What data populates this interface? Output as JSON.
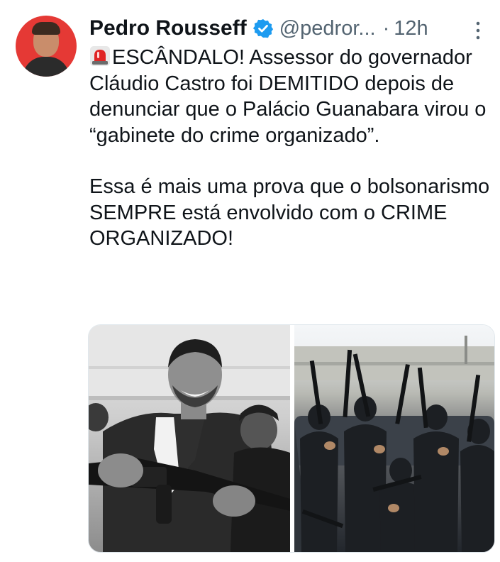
{
  "author": {
    "name": "Pedro Rousseff",
    "handle": "@pedror...",
    "separator": "·",
    "time": "12h",
    "verified": true,
    "avatar_bg": "#e53935"
  },
  "tweet": {
    "emoji": "rotating-light-icon",
    "paragraphs": [
      "ESCÂNDALO! Assessor do governador Cláudio Castro foi DEMITIDO depois de denunciar que o Palácio Guanabara virou o “gabinete do crime organizado”.",
      "Essa é mais uma prova que o bolsonarismo SEMPRE está envolvido com o CRIME ORGANIZADO!"
    ]
  },
  "media": {
    "count": 2,
    "items": [
      {
        "kind": "photo",
        "tone": "black-and-white"
      },
      {
        "kind": "photo",
        "tone": "color"
      }
    ]
  },
  "colors": {
    "text": "#0f1419",
    "secondary": "#536471",
    "verified": "#1d9bf0"
  }
}
